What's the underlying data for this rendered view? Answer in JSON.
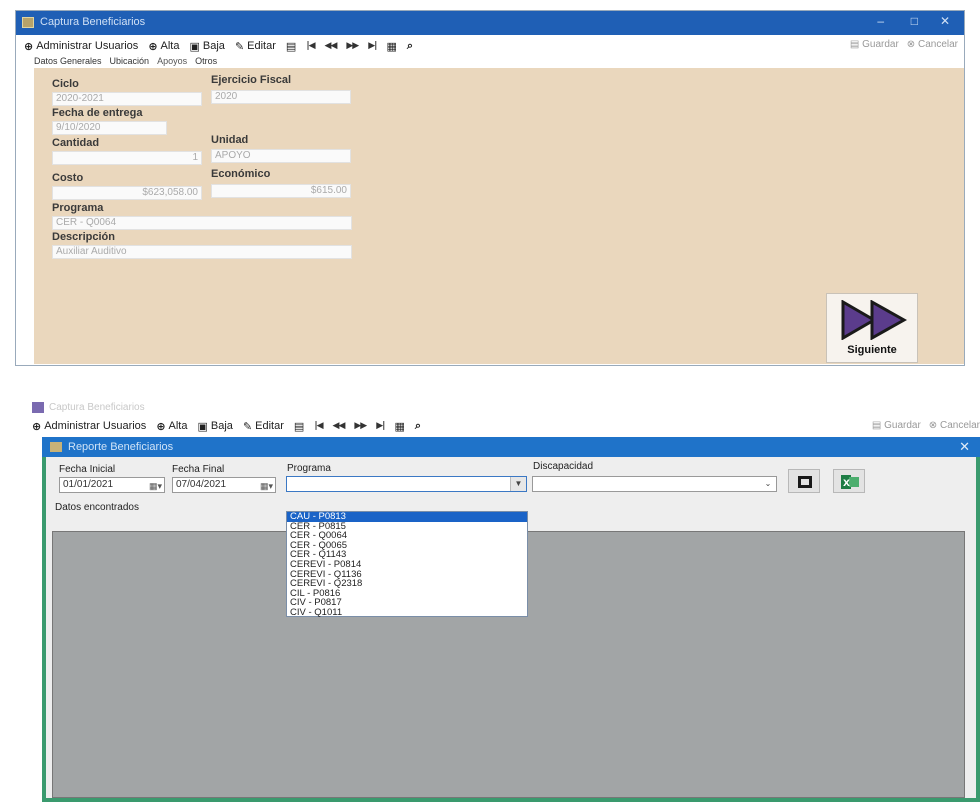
{
  "top_window": {
    "title": "Captura Beneficiarios",
    "toolbar": {
      "admin_users": "Administrar Usuarios",
      "alta": "Alta",
      "baja": "Baja",
      "editar": "Editar",
      "guardar": "Guardar",
      "cancelar": "Cancelar"
    },
    "tabs": [
      "Datos Generales",
      "Ubicación",
      "Apoyos",
      "Otros"
    ],
    "form": {
      "ciclo_label": "Ciclo",
      "ciclo_value": "2020-2021",
      "ejercicio_label": "Ejercicio Fiscal",
      "ejercicio_value": "2020",
      "fecha_label": "Fecha de entrega",
      "fecha_value": "9/10/2020",
      "cantidad_label": "Cantidad",
      "cantidad_value": "1",
      "unidad_label": "Unidad",
      "unidad_value": "APOYO",
      "costo_label": "Costo",
      "costo_value": "$623,058.00",
      "economico_label": "Económico",
      "economico_value": "$615.00",
      "programa_label": "Programa",
      "programa_value": "CER - Q0064",
      "descripcion_label": "Descripción",
      "descripcion_value": "Auxiliar Auditivo"
    },
    "next_button_label": "Siguiente"
  },
  "bottom_window": {
    "title": "Captura Beneficiarios",
    "toolbar": {
      "admin_users": "Administrar Usuarios",
      "alta": "Alta",
      "baja": "Baja",
      "editar": "Editar",
      "guardar": "Guardar",
      "cancelar": "Cancelar"
    },
    "dialog": {
      "title": "Reporte Beneficiarios",
      "fecha_inicial_label": "Fecha Inicial",
      "fecha_inicial_value": "01/01/2021",
      "fecha_final_label": "Fecha Final",
      "fecha_final_value": "07/04/2021",
      "programa_label": "Programa",
      "discapacidad_label": "Discapacidad",
      "datos_label": "Datos encontrados",
      "programa_options": [
        "CAU - P0813",
        "CER - P0815",
        "CER - Q0064",
        "CER - Q0065",
        "CER - Q1143",
        "CEREVI - P0814",
        "CEREVI - Q1136",
        "CEREVI - Q2318",
        "CIL - P0816",
        "CIV - P0817",
        "CIV - Q1011"
      ],
      "selected_option_index": 0
    }
  },
  "colors": {
    "titlebar": "#1f5fb5",
    "form_panel": "#ead7bd",
    "dialog_border": "#3a9a6e",
    "grid_bg": "#a2a5a6",
    "selection": "#1a63c7",
    "next_arrow": "#5b3c8c"
  },
  "icons": [
    "app-icon",
    "add-user-icon",
    "alta-icon",
    "baja-icon",
    "editar-icon",
    "first-icon",
    "prev-icon",
    "next-icon",
    "last-icon",
    "report-icon",
    "export-icon",
    "save-icon",
    "cancel-icon",
    "fast-forward-icon",
    "excel-icon"
  ]
}
